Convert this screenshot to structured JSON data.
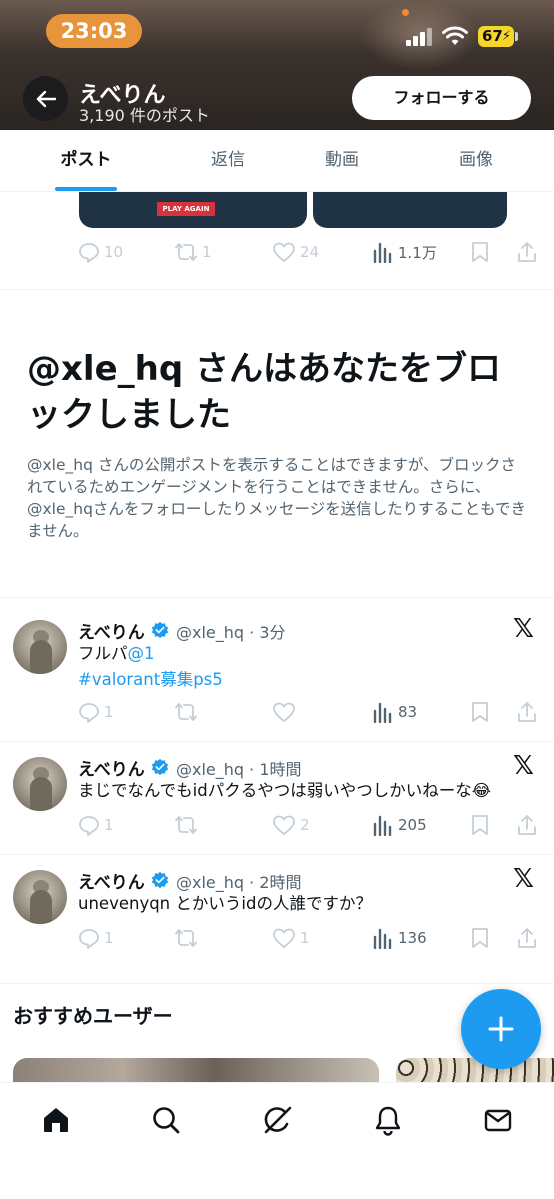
{
  "status_bar": {
    "time": "23:03",
    "battery": "67"
  },
  "profile": {
    "name": "えべりん",
    "post_count": "3,190 件のポスト",
    "follow_label": "フォローする"
  },
  "tabs": [
    {
      "label": "ポスト",
      "active": true
    },
    {
      "label": "返信",
      "active": false
    },
    {
      "label": "動画",
      "active": false
    },
    {
      "label": "画像",
      "active": false
    }
  ],
  "top_post": {
    "media_label": "PLAY AGAIN",
    "replies": "10",
    "reposts": "1",
    "likes": "24",
    "views": "1.1万"
  },
  "block_notice": {
    "title": "@xle_hq さんはあなたをブロックしました",
    "description": "@xle_hq さんの公開ポストを表示することはできますが、ブロックされているためエンゲージメントを行うことはできません。さらに、@xle_hqさんをフォローしたりメッセージを送信したりすることもできません。"
  },
  "posts": [
    {
      "name": "えべりん",
      "meta": "@xle_hq · 3分",
      "line1_prefix": "フルパ",
      "line1_link": "@1",
      "line2_link": "#valorant募集ps5",
      "replies": "1",
      "reposts": "",
      "likes": "",
      "views": "83"
    },
    {
      "name": "えべりん",
      "meta": "@xle_hq · 1時間",
      "text": "まじでなんでもidパクるやつは弱いやつしかいねーな😂",
      "replies": "1",
      "reposts": "",
      "likes": "2",
      "views": "205"
    },
    {
      "name": "えべりん",
      "meta": "@xle_hq · 2時間",
      "text": "unevenyqn とかいうidの人誰ですか？",
      "replies": "1",
      "reposts": "",
      "likes": "1",
      "views": "136"
    }
  ],
  "recommended": {
    "title": "おすすめユーザー"
  },
  "icons": {
    "back": "arrow-left-icon",
    "x_logo": "𝕏",
    "fab": "plus-icon",
    "nav": [
      "home-icon",
      "search-icon",
      "grok-icon",
      "bell-icon",
      "mail-icon"
    ]
  },
  "colors": {
    "accent": "#1d9bf0",
    "text": "#0f1419",
    "muted": "#536471"
  }
}
